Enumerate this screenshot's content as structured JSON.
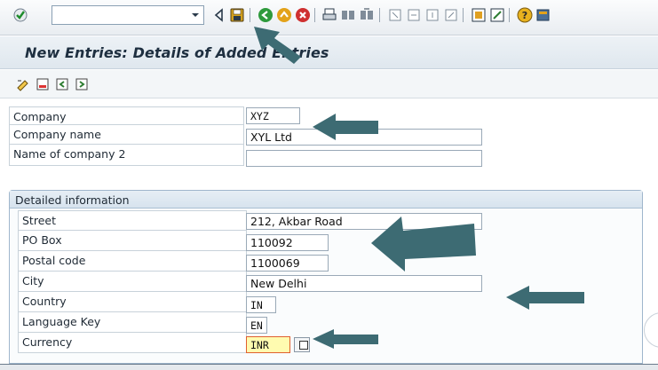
{
  "toolbar": {
    "command_placeholder": "",
    "icons": [
      "check-icon",
      "dropdown-icon",
      "back-triangle-icon",
      "save-icon",
      "back-icon",
      "exit-icon",
      "cancel-icon",
      "print-icon",
      "find-icon",
      "find-next-icon",
      "first-page-icon",
      "previous-page-icon",
      "next-page-icon",
      "last-page-icon",
      "create-session-icon",
      "shortcut-icon",
      "help-icon",
      "customize-icon"
    ]
  },
  "title": "New Entries: Details of Added Entries",
  "fields": {
    "company_label": "Company",
    "company_value": "XYZ",
    "company_name_label": "Company name",
    "company_name_value": "XYL Ltd",
    "company2_label": "Name of company 2",
    "company2_value": ""
  },
  "detailed": {
    "title": "Detailed information",
    "street_label": "Street",
    "street_value": "212, Akbar Road",
    "pobox_label": "PO Box",
    "pobox_value": "110092",
    "postal_label": "Postal code",
    "postal_value": "1100069",
    "city_label": "City",
    "city_value": "New Delhi",
    "country_label": "Country",
    "country_value": "IN",
    "language_label": "Language Key",
    "language_value": "EN",
    "currency_label": "Currency",
    "currency_value": "INR"
  },
  "colors": {
    "arrow": "#3d6b73",
    "title_bg": "#e4ebf1",
    "group_border": "#9fb6cc",
    "currency_bg": "#fffbb0"
  }
}
